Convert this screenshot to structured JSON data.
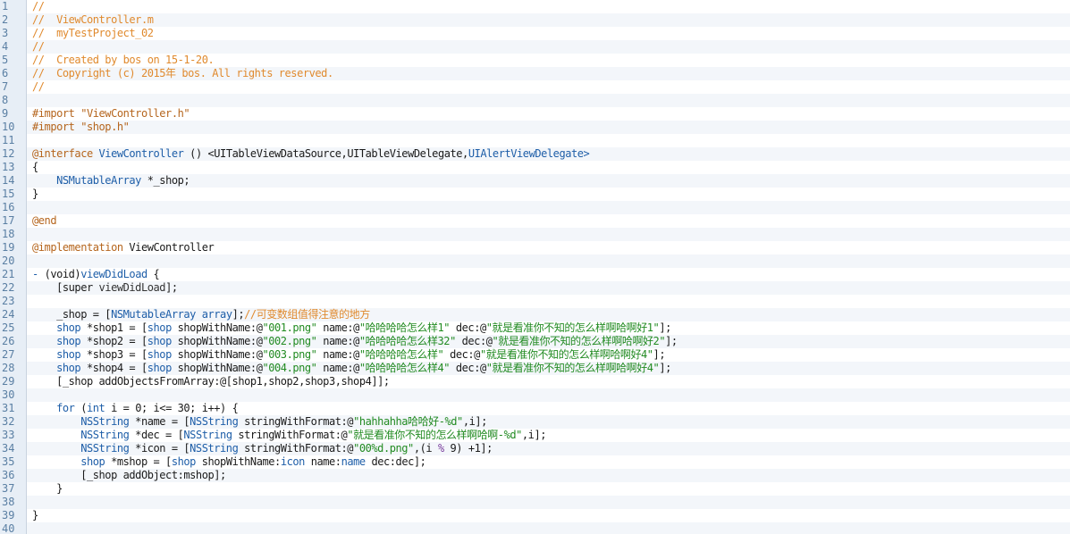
{
  "editor": {
    "lines": [
      {
        "n": "1",
        "t": [
          [
            "comment",
            "//"
          ]
        ]
      },
      {
        "n": "2",
        "t": [
          [
            "comment",
            "//  ViewController.m"
          ]
        ]
      },
      {
        "n": "3",
        "t": [
          [
            "comment",
            "//  myTestProject_02"
          ]
        ]
      },
      {
        "n": "4",
        "t": [
          [
            "comment",
            "//"
          ]
        ]
      },
      {
        "n": "5",
        "t": [
          [
            "comment",
            "//  Created by bos on 15-1-20."
          ]
        ]
      },
      {
        "n": "6",
        "t": [
          [
            "comment",
            "//  Copyright (c) 2015年 bos. All rights reserved."
          ]
        ]
      },
      {
        "n": "7",
        "t": [
          [
            "comment",
            "//"
          ]
        ]
      },
      {
        "n": "8",
        "t": []
      },
      {
        "n": "9",
        "t": [
          [
            "directive",
            "#import "
          ],
          [
            "directive",
            "\"ViewController.h\""
          ]
        ]
      },
      {
        "n": "10",
        "t": [
          [
            "directive",
            "#import "
          ],
          [
            "directive",
            "\"shop.h\""
          ]
        ]
      },
      {
        "n": "11",
        "t": []
      },
      {
        "n": "12",
        "t": [
          [
            "directive",
            "@interface"
          ],
          [
            "plain",
            " "
          ],
          [
            "type",
            "ViewController"
          ],
          [
            "plain",
            " () <"
          ],
          [
            "ident",
            "UITableViewDataSource"
          ],
          [
            "plain",
            ","
          ],
          [
            "ident",
            "UITableViewDelegate"
          ],
          [
            "plain",
            ","
          ],
          [
            "proto",
            "UIAlertViewDelegate"
          ],
          [
            "proto",
            ">"
          ]
        ]
      },
      {
        "n": "13",
        "t": [
          [
            "plain",
            "{"
          ]
        ]
      },
      {
        "n": "14",
        "t": [
          [
            "plain",
            "    "
          ],
          [
            "type",
            "NSMutableArray"
          ],
          [
            "plain",
            " *_shop;"
          ]
        ]
      },
      {
        "n": "15",
        "t": [
          [
            "plain",
            "}"
          ]
        ]
      },
      {
        "n": "16",
        "t": []
      },
      {
        "n": "17",
        "t": [
          [
            "directive",
            "@end"
          ]
        ]
      },
      {
        "n": "18",
        "t": []
      },
      {
        "n": "19",
        "t": [
          [
            "directive",
            "@implementation"
          ],
          [
            "plain",
            " ViewController"
          ]
        ]
      },
      {
        "n": "20",
        "t": []
      },
      {
        "n": "21",
        "t": [
          [
            "keyword",
            "- "
          ],
          [
            "plain",
            "(void)"
          ],
          [
            "type",
            "viewDidLoad"
          ],
          [
            "plain",
            " {"
          ]
        ]
      },
      {
        "n": "22",
        "t": [
          [
            "plain",
            "    [super "
          ],
          [
            "method",
            "viewDidLoad"
          ],
          [
            "plain",
            "];"
          ]
        ]
      },
      {
        "n": "23",
        "t": []
      },
      {
        "n": "24",
        "t": [
          [
            "plain",
            "    _shop = ["
          ],
          [
            "type",
            "NSMutableArray"
          ],
          [
            "plain",
            " "
          ],
          [
            "type",
            "array"
          ],
          [
            "plain",
            "];"
          ],
          [
            "comment",
            "//可变数组值得注意的地方"
          ]
        ]
      },
      {
        "n": "25",
        "t": [
          [
            "plain",
            "    "
          ],
          [
            "type",
            "shop"
          ],
          [
            "plain",
            " *shop1 = ["
          ],
          [
            "type",
            "shop"
          ],
          [
            "plain",
            " shopWithName:@"
          ],
          [
            "string",
            "\"001.png\""
          ],
          [
            "plain",
            " name:@"
          ],
          [
            "string",
            "\"哈哈哈哈怎么样1\""
          ],
          [
            "plain",
            " dec:@"
          ],
          [
            "string",
            "\"就是看准你不知的怎么样啊哈啊好1\""
          ],
          [
            "plain",
            "];"
          ]
        ]
      },
      {
        "n": "26",
        "t": [
          [
            "plain",
            "    "
          ],
          [
            "type",
            "shop"
          ],
          [
            "plain",
            " *shop2 = ["
          ],
          [
            "type",
            "shop"
          ],
          [
            "plain",
            " shopWithName:@"
          ],
          [
            "string",
            "\"002.png\""
          ],
          [
            "plain",
            " name:@"
          ],
          [
            "string",
            "\"哈哈哈哈怎么样32\""
          ],
          [
            "plain",
            " dec:@"
          ],
          [
            "string",
            "\"就是看准你不知的怎么样啊哈啊好2\""
          ],
          [
            "plain",
            "];"
          ]
        ]
      },
      {
        "n": "27",
        "t": [
          [
            "plain",
            "    "
          ],
          [
            "type",
            "shop"
          ],
          [
            "plain",
            " *shop3 = ["
          ],
          [
            "type",
            "shop"
          ],
          [
            "plain",
            " shopWithName:@"
          ],
          [
            "string",
            "\"003.png\""
          ],
          [
            "plain",
            " name:@"
          ],
          [
            "string",
            "\"哈哈哈哈怎么样\""
          ],
          [
            "plain",
            " dec:@"
          ],
          [
            "string",
            "\"就是看准你不知的怎么样啊哈啊好4\""
          ],
          [
            "plain",
            "];"
          ]
        ]
      },
      {
        "n": "28",
        "t": [
          [
            "plain",
            "    "
          ],
          [
            "type",
            "shop"
          ],
          [
            "plain",
            " *shop4 = ["
          ],
          [
            "type",
            "shop"
          ],
          [
            "plain",
            " shopWithName:@"
          ],
          [
            "string",
            "\"004.png\""
          ],
          [
            "plain",
            " name:@"
          ],
          [
            "string",
            "\"哈哈哈哈怎么样4\""
          ],
          [
            "plain",
            " dec:@"
          ],
          [
            "string",
            "\"就是看准你不知的怎么样啊哈啊好4\""
          ],
          [
            "plain",
            "];"
          ]
        ]
      },
      {
        "n": "29",
        "t": [
          [
            "plain",
            "    [_shop addObjectsFromArray:@[shop1,shop2,shop3,shop4]];"
          ]
        ]
      },
      {
        "n": "30",
        "t": []
      },
      {
        "n": "31",
        "t": [
          [
            "plain",
            "    "
          ],
          [
            "keyword",
            "for"
          ],
          [
            "plain",
            " ("
          ],
          [
            "keyword",
            "int"
          ],
          [
            "plain",
            " i = 0; i<= 30; i++) {"
          ]
        ]
      },
      {
        "n": "32",
        "t": [
          [
            "plain",
            "        "
          ],
          [
            "type",
            "NSString"
          ],
          [
            "plain",
            " *name = ["
          ],
          [
            "type",
            "NSString"
          ],
          [
            "plain",
            " stringWithFormat:@"
          ],
          [
            "string",
            "\"hahhahha哈哈好-%d\""
          ],
          [
            "plain",
            ",i];"
          ]
        ]
      },
      {
        "n": "33",
        "t": [
          [
            "plain",
            "        "
          ],
          [
            "type",
            "NSString"
          ],
          [
            "plain",
            " *dec = ["
          ],
          [
            "type",
            "NSString"
          ],
          [
            "plain",
            " stringWithFormat:@"
          ],
          [
            "string",
            "\"就是看准你不知的怎么样啊哈啊-%d\""
          ],
          [
            "plain",
            ",i];"
          ]
        ]
      },
      {
        "n": "34",
        "t": [
          [
            "plain",
            "        "
          ],
          [
            "type",
            "NSString"
          ],
          [
            "plain",
            " *icon = ["
          ],
          [
            "type",
            "NSString"
          ],
          [
            "plain",
            " stringWithFormat:@"
          ],
          [
            "string",
            "\"00%d.png\""
          ],
          [
            "plain",
            ",(i "
          ],
          [
            "op",
            "%"
          ],
          [
            "plain",
            " 9) +1];"
          ]
        ]
      },
      {
        "n": "35",
        "t": [
          [
            "plain",
            "        "
          ],
          [
            "type",
            "shop"
          ],
          [
            "plain",
            " *mshop = ["
          ],
          [
            "type",
            "shop"
          ],
          [
            "plain",
            " shopWithName:"
          ],
          [
            "type",
            "icon"
          ],
          [
            "plain",
            " name:"
          ],
          [
            "type",
            "name"
          ],
          [
            "plain",
            " dec:dec];"
          ]
        ]
      },
      {
        "n": "36",
        "t": [
          [
            "plain",
            "        [_shop addObject:mshop];"
          ]
        ]
      },
      {
        "n": "37",
        "t": [
          [
            "plain",
            "    }"
          ]
        ]
      },
      {
        "n": "38",
        "t": []
      },
      {
        "n": "39",
        "t": [
          [
            "plain",
            "}"
          ]
        ]
      },
      {
        "n": "40",
        "t": []
      }
    ]
  },
  "colors": {
    "comment": "#e08a2e",
    "directive": "#b5651d",
    "string": "#228b22",
    "type": "#1e5ea8",
    "gutter_bg": "#e7eef6",
    "line_number": "#5a7fa3"
  }
}
